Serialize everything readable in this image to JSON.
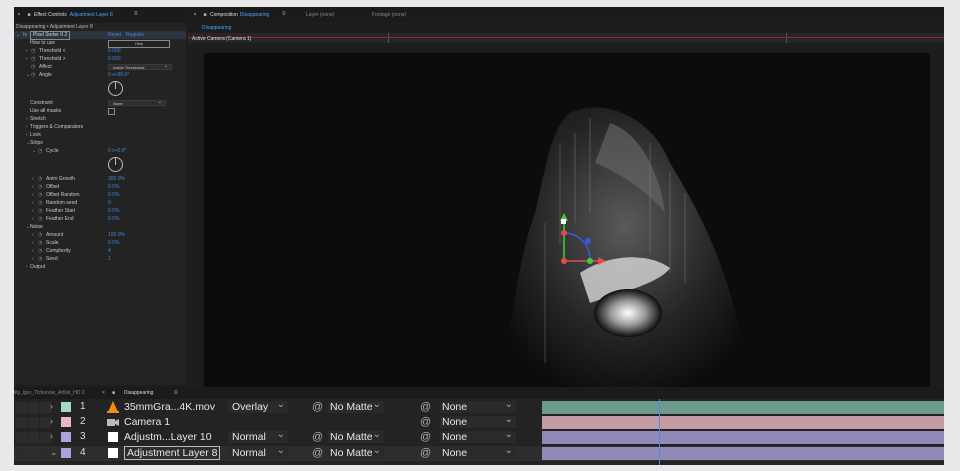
{
  "effect_controls": {
    "tab_title": "Effect Controls",
    "tab_layer": "Adjustment Layer 8",
    "subtitle": "Disappearing • Adjustment Layer 8",
    "effect_name": "Pixel Sorter II 2",
    "reset_label": "Reset",
    "register_label": "Register",
    "how_to_use_label": "How to use",
    "help_label": "Help",
    "threshold_lt_label": "Threshold <",
    "threshold_lt_value": "0.000",
    "threshold_gt_label": "Threshold >",
    "threshold_gt_value": "0.650",
    "affect_label": "Affect",
    "affect_value": "Inside Thresholds",
    "angle_label": "Angle",
    "angle_value": "0 x+90.0°",
    "constraint_label": "Constraint",
    "constraint_value": "None",
    "use_all_masks_label": "Use all masks",
    "stretch_label": "Stretch",
    "triggers_label": "Triggers & Comparators",
    "look_label": "Look",
    "strips_label": "Strips",
    "cycle_label": "Cycle",
    "cycle_value": "0 x+0.0°",
    "anim_growth_label": "Anim Growth",
    "anim_growth_value": "200.0%",
    "offset_label": "Offset",
    "offset_value": "0.0%",
    "offset_random_label": "Offset Random",
    "offset_random_value": "0.0%",
    "random_seed_label": "Random seed",
    "random_seed_value": "0",
    "feather_start_label": "Feather Start",
    "feather_start_value": "0.0%",
    "feather_end_label": "Feather End",
    "feather_end_value": "0.0%",
    "noise_label": "Noise",
    "amount_label": "Amount",
    "amount_value": "100.0%",
    "scale_label": "Scale",
    "scale_value": "0.0%",
    "complexity_label": "Complexity",
    "complexity_value": "4",
    "seed_label": "Seed",
    "seed_value": "1",
    "output_label": "Output"
  },
  "composition": {
    "tab_title": "Composition",
    "tab_name": "Disappearing",
    "layer_tab": "Layer (none)",
    "footage_tab": "Footage (none)",
    "breadcrumb": "Disappearing",
    "view_label": "Active Camera (Camera 1)"
  },
  "timeline": {
    "project_label": "lity_igor_Tichonow_Artlist_HD 2",
    "tab_name": "Disappearing",
    "layers": [
      {
        "num": "1",
        "name": "35mmGra...4K.mov",
        "mode": "Overlay",
        "matte": "No Matte",
        "parent": "None",
        "label_color": "#a3d9c0",
        "bar_color": "#6e9a8c"
      },
      {
        "num": "2",
        "name": "Camera 1",
        "mode": "",
        "matte": "",
        "parent": "None",
        "label_color": "#e7b9c3",
        "bar_color": "#c49aa3"
      },
      {
        "num": "3",
        "name": "Adjustm...Layer 10",
        "mode": "Normal",
        "matte": "No Matte",
        "parent": "None",
        "label_color": "#a9a4d9",
        "bar_color": "#8f8ab8"
      },
      {
        "num": "4",
        "name": "Adjustment Layer 8",
        "mode": "Normal",
        "matte": "No Matte",
        "parent": "None",
        "label_color": "#a9a4d9",
        "bar_color": "#8f8ab8"
      }
    ]
  },
  "colors": {
    "accent_blue": "#4aa3ff",
    "value_blue": "#3d8bd8",
    "panel_bg": "#232323",
    "viewer_bg": "#0c0c0c"
  }
}
